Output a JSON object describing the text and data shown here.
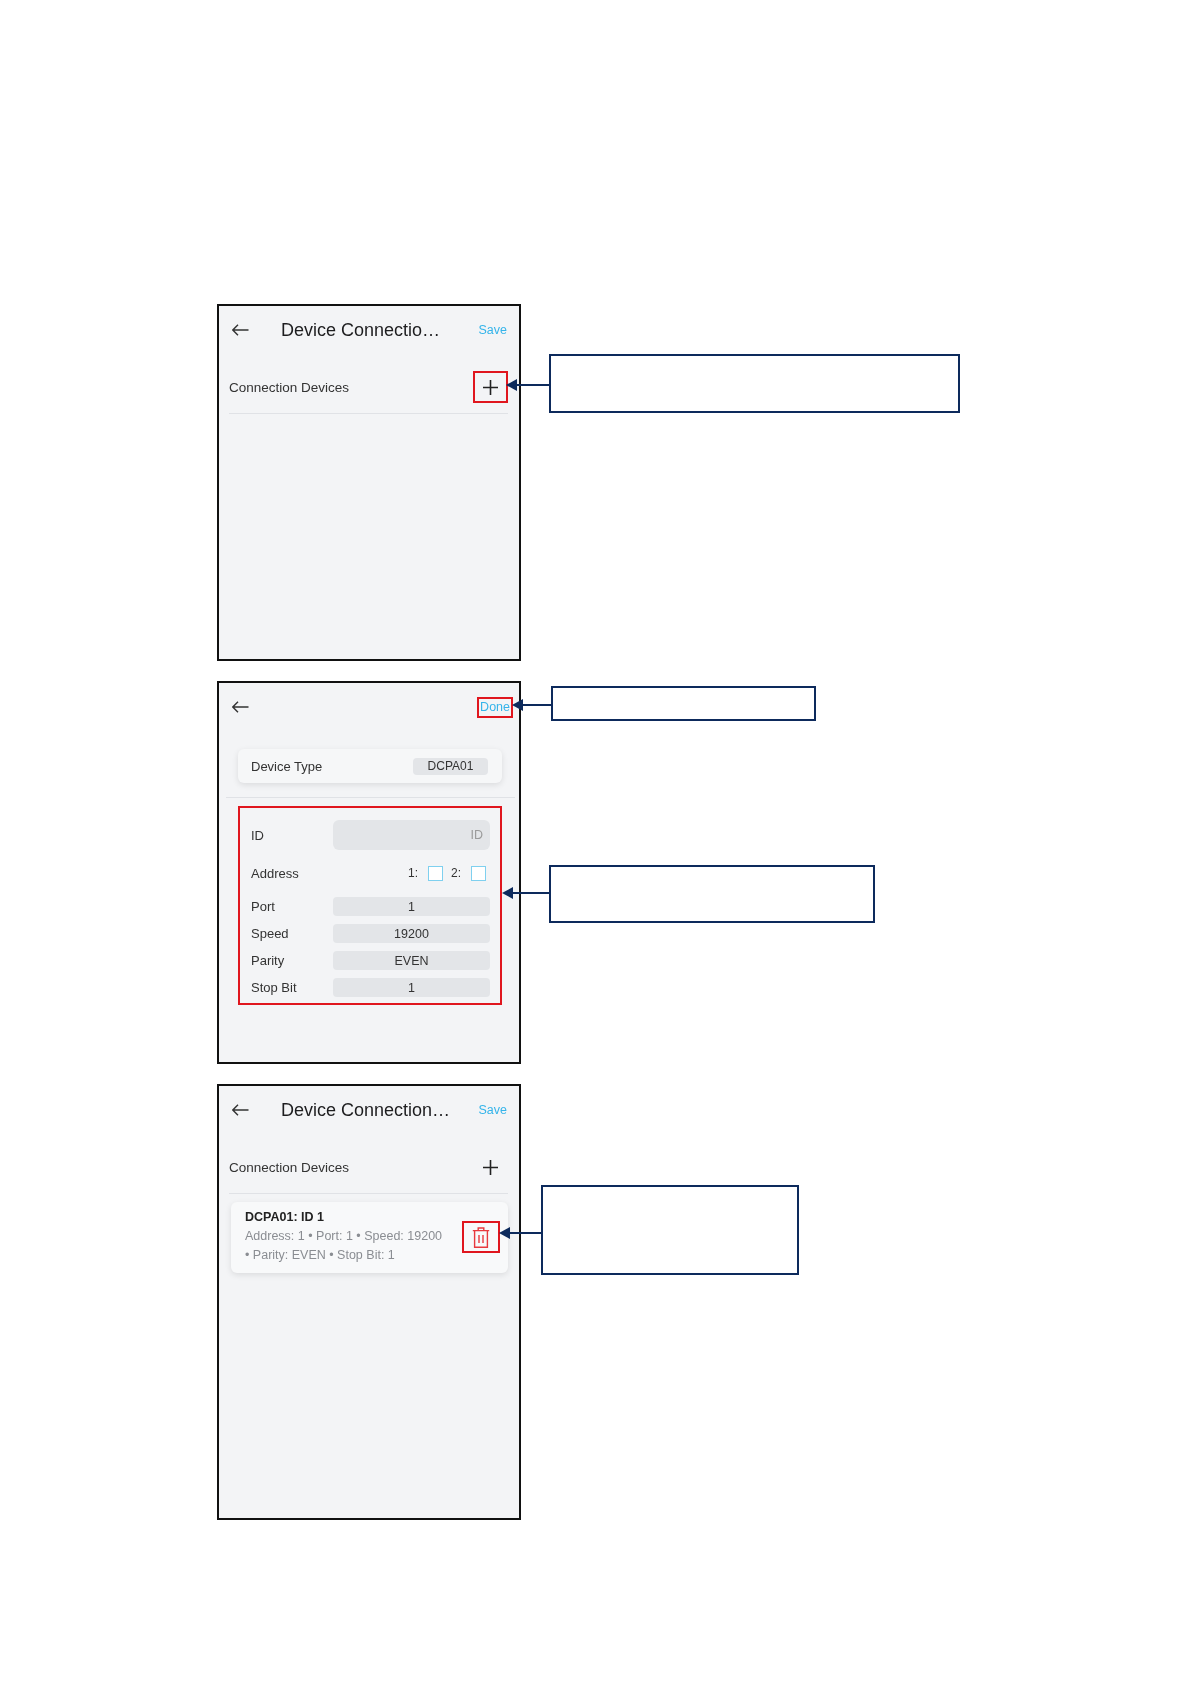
{
  "screens": [
    {
      "kind": "list",
      "header": {
        "title": "Device Connectio…",
        "action": {
          "label": "Save",
          "highlighted": false
        }
      },
      "section": {
        "label": "Connection Devices",
        "add_button": {
          "highlighted": true
        }
      }
    },
    {
      "kind": "form",
      "header": {
        "action": {
          "label": "Done",
          "highlighted": true
        }
      },
      "device_type": {
        "label": "Device Type",
        "value": "DCPA01"
      },
      "fields": {
        "highlighted": true,
        "items": [
          {
            "kind": "text",
            "label": "ID",
            "placeholder": "ID"
          },
          {
            "kind": "address",
            "label": "Address",
            "options": [
              {
                "label": "1:",
                "checked": false
              },
              {
                "label": "2:",
                "checked": false
              }
            ]
          },
          {
            "kind": "select",
            "label": "Port",
            "value": "1"
          },
          {
            "kind": "select",
            "label": "Speed",
            "value": "19200"
          },
          {
            "kind": "select",
            "label": "Parity",
            "value": "EVEN"
          },
          {
            "kind": "select",
            "label": "Stop Bit",
            "value": "1"
          }
        ]
      }
    },
    {
      "kind": "list",
      "header": {
        "title": "Device Connection…",
        "action": {
          "label": "Save",
          "highlighted": false
        }
      },
      "section": {
        "label": "Connection Devices",
        "add_button": {
          "highlighted": false
        }
      },
      "devices": [
        {
          "title": "DCPA01: ID 1",
          "details": "Address: 1 • Port: 1 • Speed: 19200 • Parity: EVEN • Stop Bit: 1",
          "delete_button": {
            "highlighted": true
          }
        }
      ]
    }
  ]
}
